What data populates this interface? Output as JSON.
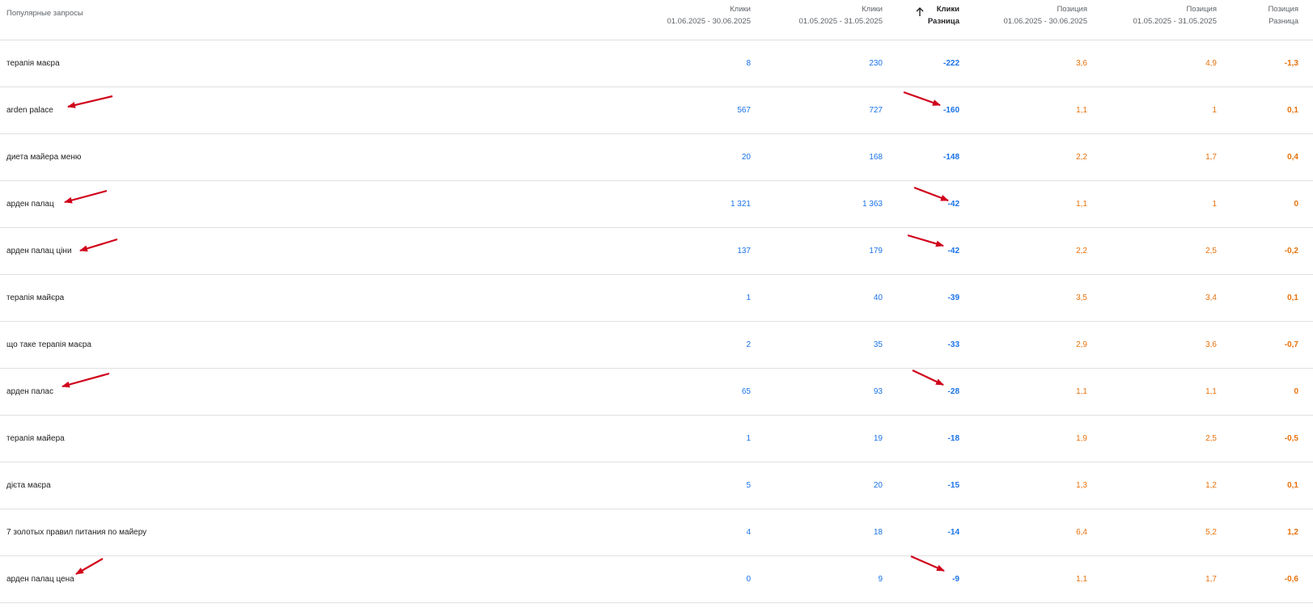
{
  "header": {
    "query": "Популярные запросы",
    "cols": [
      {
        "l1": "Клики",
        "l2": "01.06.2025 - 30.06.2025"
      },
      {
        "l1": "Клики",
        "l2": "01.05.2025 - 31.05.2025"
      },
      {
        "l1": "Клики",
        "l2": "Разница"
      },
      {
        "l1": "Позиция",
        "l2": "01.06.2025 - 30.06.2025"
      },
      {
        "l1": "Позиция",
        "l2": "01.05.2025 - 31.05.2025"
      },
      {
        "l1": "Позиция",
        "l2": "Разница"
      }
    ]
  },
  "rows": [
    {
      "q": "терапія маєра",
      "c1": "8",
      "c2": "230",
      "cd": "-222",
      "p1": "3,6",
      "p2": "4,9",
      "pd": "-1,3"
    },
    {
      "q": "arden palace",
      "c1": "567",
      "c2": "727",
      "cd": "-160",
      "p1": "1,1",
      "p2": "1",
      "pd": "0,1"
    },
    {
      "q": "диета майера меню",
      "c1": "20",
      "c2": "168",
      "cd": "-148",
      "p1": "2,2",
      "p2": "1,7",
      "pd": "0,4"
    },
    {
      "q": "арден палац",
      "c1": "1 321",
      "c2": "1 363",
      "cd": "-42",
      "p1": "1,1",
      "p2": "1",
      "pd": "0"
    },
    {
      "q": "арден палац ціни",
      "c1": "137",
      "c2": "179",
      "cd": "-42",
      "p1": "2,2",
      "p2": "2,5",
      "pd": "-0,2"
    },
    {
      "q": "терапія майєра",
      "c1": "1",
      "c2": "40",
      "cd": "-39",
      "p1": "3,5",
      "p2": "3,4",
      "pd": "0,1"
    },
    {
      "q": "що таке терапія маєра",
      "c1": "2",
      "c2": "35",
      "cd": "-33",
      "p1": "2,9",
      "p2": "3,6",
      "pd": "-0,7"
    },
    {
      "q": "арден палас",
      "c1": "65",
      "c2": "93",
      "cd": "-28",
      "p1": "1,1",
      "p2": "1,1",
      "pd": "0"
    },
    {
      "q": "терапія майера",
      "c1": "1",
      "c2": "19",
      "cd": "-18",
      "p1": "1,9",
      "p2": "2,5",
      "pd": "-0,5"
    },
    {
      "q": "дієта маєра",
      "c1": "5",
      "c2": "20",
      "cd": "-15",
      "p1": "1,3",
      "p2": "1,2",
      "pd": "0,1"
    },
    {
      "q": "7 золотых правил питания по майеру",
      "c1": "4",
      "c2": "18",
      "cd": "-14",
      "p1": "6,4",
      "p2": "5,2",
      "pd": "1,2"
    },
    {
      "q": "арден палац цена",
      "c1": "0",
      "c2": "9",
      "cd": "-9",
      "p1": "1,1",
      "p2": "1,7",
      "pd": "-0,6"
    }
  ],
  "colors": {
    "clicks": "#1a73e8",
    "position": "#e8710a",
    "annotation_arrow": "#d0021b"
  },
  "icons": {
    "sort": "arrow-up-icon"
  }
}
